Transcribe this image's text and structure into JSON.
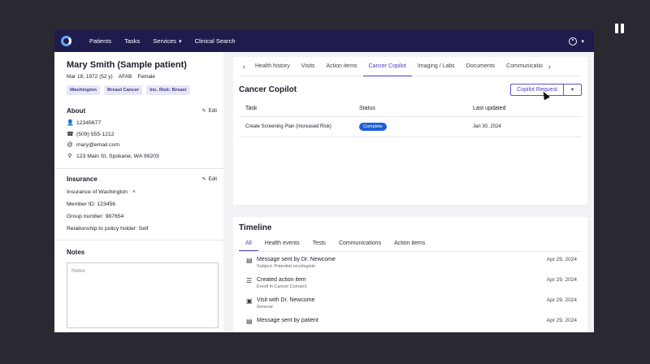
{
  "nav": {
    "links": [
      {
        "label": "Patients"
      },
      {
        "label": "Tasks"
      },
      {
        "label": "Services"
      },
      {
        "label": "Clinical Search"
      }
    ]
  },
  "patient": {
    "name": "Mary Smith (Sample patient)",
    "dob": "Mar 18, 1972 (52 y)",
    "sex_at_birth": "AFAB",
    "gender": "Female",
    "tags": [
      "Washington",
      "Breast Cancer",
      "Inc. Risk: Breast"
    ]
  },
  "about": {
    "title": "About",
    "edit_label": "Edit",
    "id": "12345677",
    "phone": "(509) 555-1212",
    "email": "mary@email.com",
    "address": "123 Main St, Spokane, WA 99203"
  },
  "insurance": {
    "title": "Insurance",
    "edit_label": "Edit",
    "plan": "Insurance of Washington",
    "member_id": "Member ID: 123456",
    "group_number": "Group number: 987654",
    "relationship": "Relationship to policy holder: Self"
  },
  "notes": {
    "title": "Notes",
    "placeholder": "Notes"
  },
  "record_tabs": [
    "Health history",
    "Visits",
    "Action items",
    "Cancer Copilot",
    "Imaging / Labs",
    "Documents",
    "Communicatio"
  ],
  "copilot": {
    "title": "Cancer Copilot",
    "request_label": "Copilot Request",
    "columns": [
      "Task",
      "Status",
      "Last updated"
    ],
    "rows": [
      {
        "task": "Create Screening Plan (Increased Risk)",
        "status": "Complete",
        "updated": "Jan 30, 2024"
      }
    ]
  },
  "timeline": {
    "title": "Timeline",
    "tabs": [
      "All",
      "Health events",
      "Tests",
      "Communications",
      "Action items"
    ],
    "items": [
      {
        "title": "Message sent by Dr. Newcome",
        "subtitle": "Subject: Potential oncologists",
        "date": "Apr 29, 2024",
        "icon": "message-icon"
      },
      {
        "title": "Created action item",
        "subtitle": "Enroll in Cancer Connect",
        "date": "Apr 29, 2024",
        "icon": "list-icon"
      },
      {
        "title": "Visit with Dr. Newcome",
        "subtitle": "General",
        "date": "Apr 29, 2024",
        "icon": "calendar-icon"
      },
      {
        "title": "Message sent by patient",
        "subtitle": "",
        "date": "Apr 29, 2024",
        "icon": "message-icon"
      }
    ]
  },
  "colors": {
    "nav_bg": "#1f1c4d",
    "accent": "#4a3fc8",
    "status_complete": "#1f5fd6"
  }
}
